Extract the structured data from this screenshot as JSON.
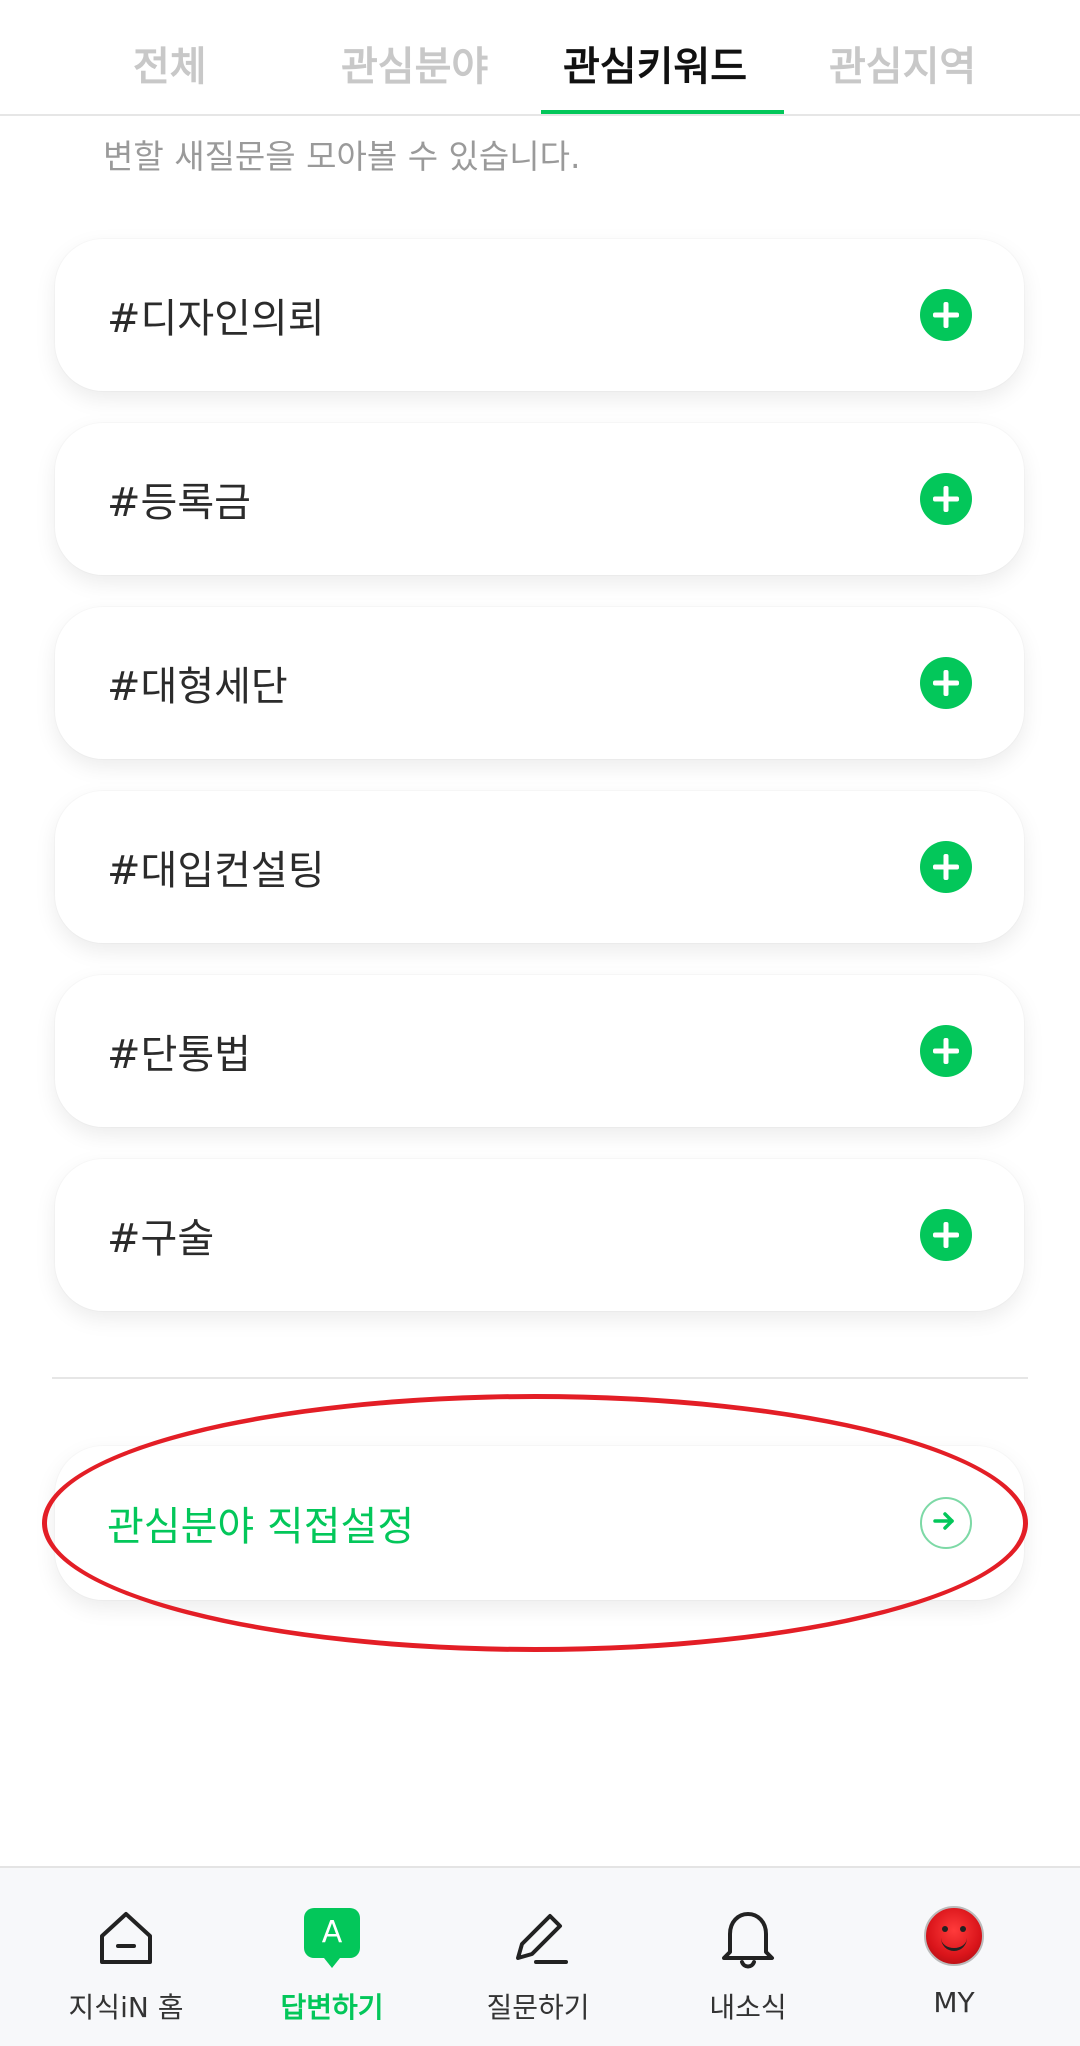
{
  "tabs": [
    {
      "label": "전체",
      "active": false
    },
    {
      "label": "관심분야",
      "active": false
    },
    {
      "label": "관심키워드",
      "active": true
    },
    {
      "label": "관심지역",
      "active": false
    }
  ],
  "subtitle": "변할 새질문을 모아볼 수 있습니다.",
  "keywords": [
    {
      "label": "#디자인의뢰",
      "action_icon": "plus-circle-icon"
    },
    {
      "label": "#등록금",
      "action_icon": "plus-circle-icon"
    },
    {
      "label": "#대형세단",
      "action_icon": "plus-circle-icon"
    },
    {
      "label": "#대입컨설팅",
      "action_icon": "plus-circle-icon"
    },
    {
      "label": "#단통법",
      "action_icon": "plus-circle-icon"
    },
    {
      "label": "#구술",
      "action_icon": "plus-circle-icon"
    }
  ],
  "direct_setting": {
    "label": "관심분야 직접설정",
    "icon": "arrow-right-circle-icon"
  },
  "bottom_nav": [
    {
      "label": "지식iN 홈",
      "icon": "home-icon",
      "active": false
    },
    {
      "label": "답변하기",
      "icon": "answer-badge-icon",
      "badge": "A",
      "active": true
    },
    {
      "label": "질문하기",
      "icon": "pencil-icon",
      "active": false
    },
    {
      "label": "내소식",
      "icon": "bell-icon",
      "active": false
    },
    {
      "label": "MY",
      "icon": "avatar",
      "active": false
    }
  ],
  "colors": {
    "accent": "#03c75a",
    "highlight": "#e31e26",
    "tab_inactive": "#c8c8c8",
    "text": "#2b2b2b"
  }
}
